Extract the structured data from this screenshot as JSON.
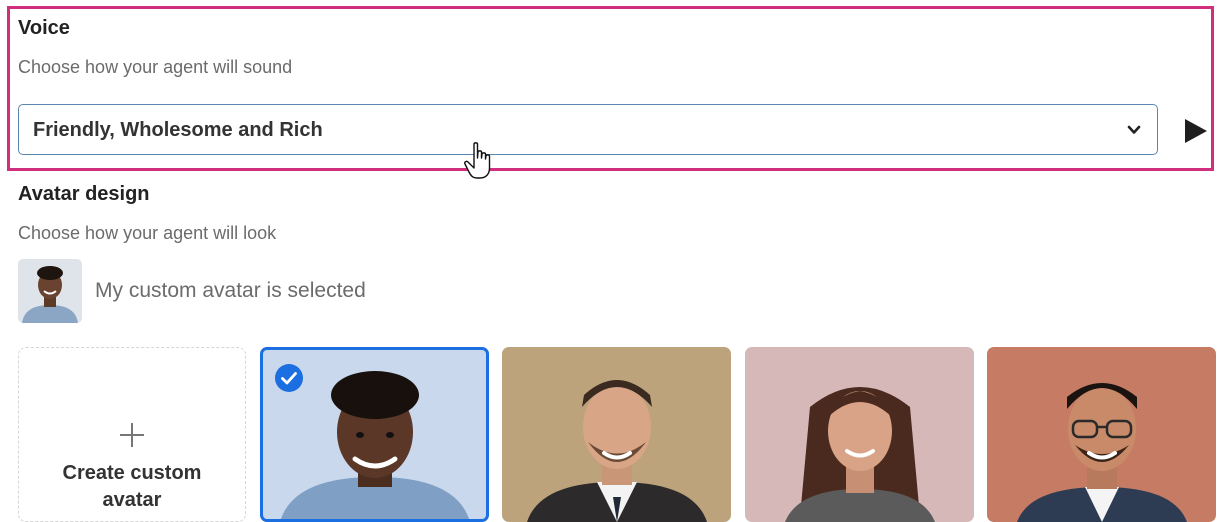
{
  "voice": {
    "title": "Voice",
    "subtitle": "Choose how your agent will sound",
    "selected_voice": "Friendly, Wholesome and Rich",
    "icons": {
      "dropdown": "chevron-down-icon",
      "play": "play-icon",
      "cursor": "hand-pointer-icon"
    }
  },
  "avatar": {
    "title": "Avatar design",
    "subtitle": "Choose how your agent will look",
    "custom_selected_text": "My custom avatar is selected",
    "create_label_line1": "Create custom",
    "create_label_line2": "avatar",
    "cards": [
      {
        "background": "#c9d8ec",
        "selected": true
      },
      {
        "background": "#bda37c",
        "selected": false
      },
      {
        "background": "#d7b8b9",
        "selected": false
      },
      {
        "background": "#c67b64",
        "selected": false
      }
    ]
  },
  "colors": {
    "highlight": "#cf2f7c",
    "accent": "#1b6fe0",
    "select_border": "#5a86b0"
  }
}
